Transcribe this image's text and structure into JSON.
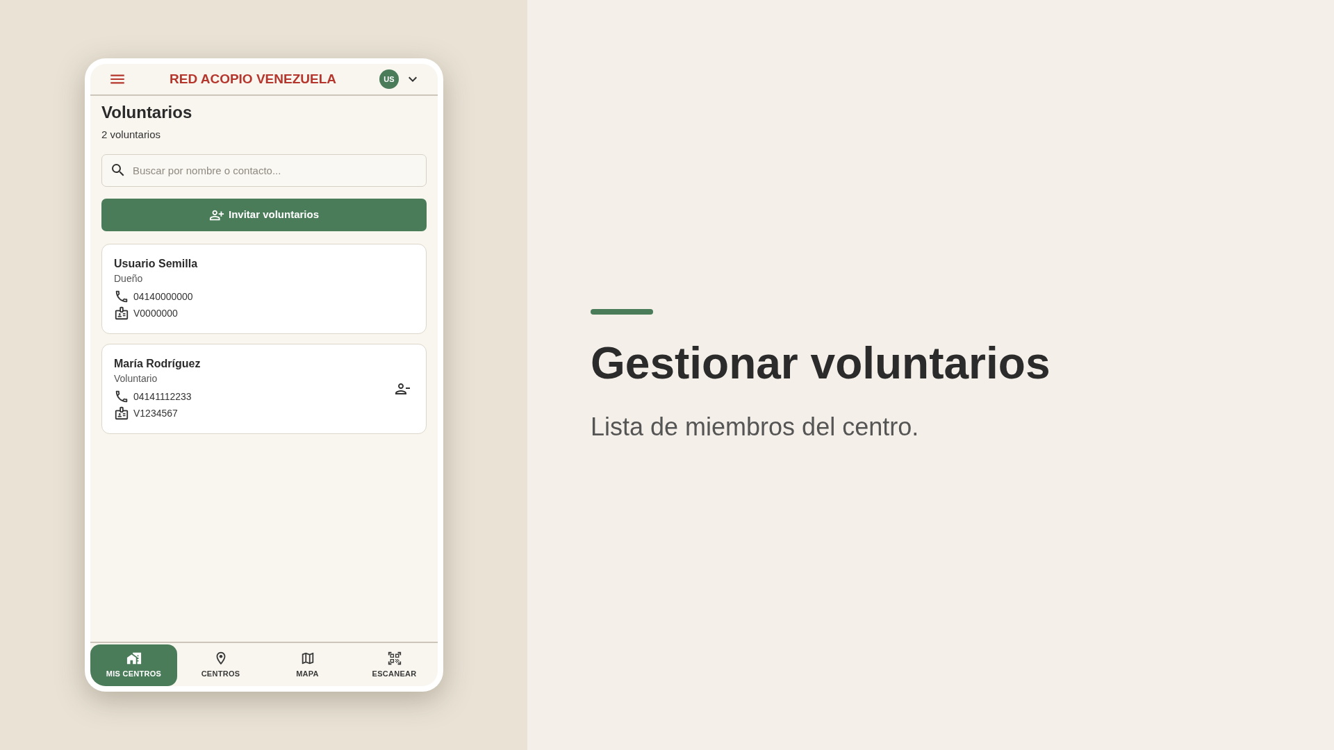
{
  "app": {
    "header": {
      "brand": "RED ACOPIO VENEZUELA",
      "avatar_initials": "US"
    },
    "page": {
      "title": "Voluntarios",
      "count": "2 voluntarios"
    },
    "search": {
      "placeholder": "Buscar por nombre o contacto..."
    },
    "invite_button": {
      "label": "Invitar voluntarios"
    },
    "volunteers": [
      {
        "name": "Usuario Semilla",
        "role": "Dueño",
        "phone": "04140000000",
        "id_number": "V0000000",
        "removable": false
      },
      {
        "name": "María Rodríguez",
        "role": "Voluntario",
        "phone": "04141112233",
        "id_number": "V1234567",
        "removable": true
      }
    ],
    "bottom_nav": [
      {
        "label": "MIS CENTROS",
        "selected": true
      },
      {
        "label": "CENTROS",
        "selected": false
      },
      {
        "label": "MAPA",
        "selected": false
      },
      {
        "label": "ESCANEAR",
        "selected": false
      }
    ]
  },
  "feature": {
    "title": "Gestionar voluntarios",
    "description": "Lista de miembros del centro."
  }
}
